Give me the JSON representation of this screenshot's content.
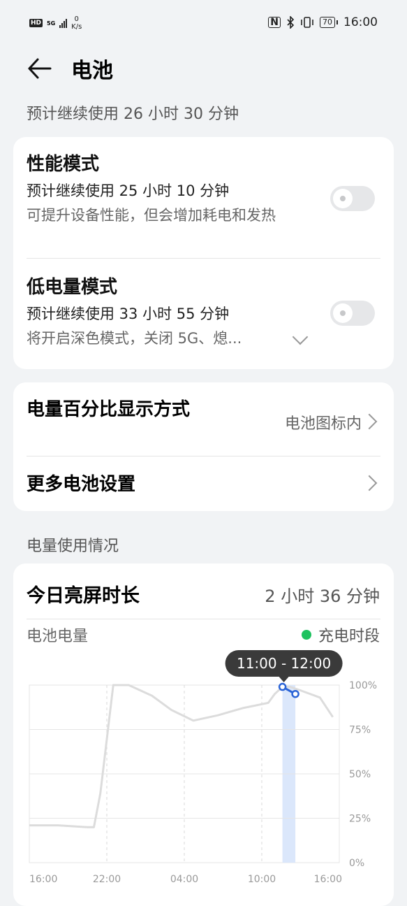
{
  "status_bar": {
    "hd_badge": "HD",
    "network": "5G",
    "net_speed_value": "0",
    "net_speed_unit": "K/s",
    "nfc_icon": "N",
    "battery_level": "70",
    "time": "16:00"
  },
  "header": {
    "title": "电池"
  },
  "estimate": "预计继续使用 26 小时 30 分钟",
  "modes": {
    "performance": {
      "title": "性能模式",
      "estimate": "预计继续使用 25 小时 10 分钟",
      "description": "可提升设备性能，但会增加耗电和发热",
      "enabled": false
    },
    "low_power": {
      "title": "低电量模式",
      "estimate": "预计继续使用 33 小时 55 分钟",
      "description": "将开启深色模式，关闭 5G、熄...",
      "enabled": false
    }
  },
  "settings": {
    "percentage_display": {
      "label": "电量百分比显示方式",
      "value": "电池图标内"
    },
    "more": {
      "label": "更多电池设置"
    }
  },
  "usage": {
    "section_title": "电量使用情况",
    "screen_time_label": "今日亮屏时长",
    "screen_time_value": "2 小时 36 分钟",
    "chart_title": "电池电量",
    "legend_charging": "充电时段",
    "tooltip": "11:00 - 12:00"
  },
  "colors": {
    "accent": "#2a63d6",
    "charging_green": "#1ec25f",
    "line_gray": "#dcdcdc",
    "selection_fill": "#dbe7fb"
  },
  "chart_data": {
    "type": "line",
    "title": "电池电量",
    "x_tick_labels": [
      "16:00",
      "22:00",
      "04:00",
      "10:00",
      "16:00"
    ],
    "y_tick_labels": [
      "100%",
      "75%",
      "50%",
      "25%",
      "0%"
    ],
    "ylim": [
      0,
      100
    ],
    "xlim_hours": [
      0,
      24
    ],
    "series": [
      {
        "name": "电池电量",
        "x_hours": [
          0,
          2.2,
          4.5,
          5.0,
          5.5,
          6.5,
          7.7,
          9.5,
          11.0,
          12.7,
          14.6,
          16.5,
          18.5,
          19.0,
          19.6,
          20.2,
          21.0,
          22.5,
          23.5
        ],
        "y": [
          21,
          21,
          20,
          20,
          39,
          100,
          100,
          94,
          86,
          80,
          83,
          87,
          90,
          95,
          99,
          99,
          97,
          93,
          82
        ]
      }
    ],
    "selected_range": [
      "11:00",
      "12:00"
    ],
    "highlight": {
      "x_hours": [
        19.6,
        20.6
      ],
      "y": [
        99,
        95
      ]
    },
    "grid": true,
    "legend": "top-right"
  }
}
